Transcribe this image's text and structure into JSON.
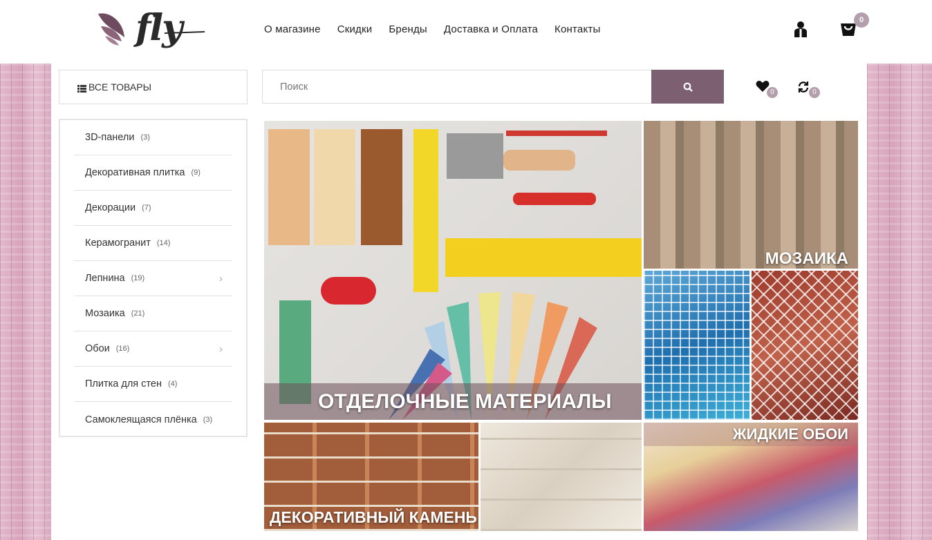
{
  "brand": {
    "logo_text": "fly",
    "accent": "#7d5f72",
    "badge_color": "#b3a0ac"
  },
  "nav": [
    "О магазине",
    "Скидки",
    "Бренды",
    "Доставка и Оплата",
    "Контакты"
  ],
  "header": {
    "user_icon": "user-icon",
    "cart_icon": "cart-icon",
    "cart_count": "0"
  },
  "sidebar": {
    "all_label": "ВСЕ ТОВАРЫ",
    "categories": [
      {
        "label": "3D-панели",
        "count": "(3)"
      },
      {
        "label": "Декоративная плитка",
        "count": "(9)"
      },
      {
        "label": "Декорации",
        "count": "(7)"
      },
      {
        "label": "Керамогранит",
        "count": "(14)"
      },
      {
        "label": "Лепнина",
        "count": "(19)",
        "has_sub": true
      },
      {
        "label": "Мозаика",
        "count": "(21)"
      },
      {
        "label": "Обои",
        "count": "(16)",
        "has_sub": true
      },
      {
        "label": "Плитка для стен",
        "count": "(4)"
      },
      {
        "label": "Самоклеящаяся плёнка",
        "count": "(3)"
      }
    ]
  },
  "search": {
    "placeholder": "Поиск",
    "button_icon": "search-icon"
  },
  "wishlist": {
    "icon": "heart-icon",
    "count": "0"
  },
  "compare": {
    "icon": "refresh-icon",
    "count": "0"
  },
  "banners": {
    "finishing": "ОТДЕЛОЧНЫЕ МАТЕРИАЛЫ",
    "mosaic": "МОЗАИКА",
    "stone": "ДЕКОРАТИВНЫЙ КАМЕНЬ",
    "liquid": "ЖИДКИЕ ОБОИ"
  }
}
